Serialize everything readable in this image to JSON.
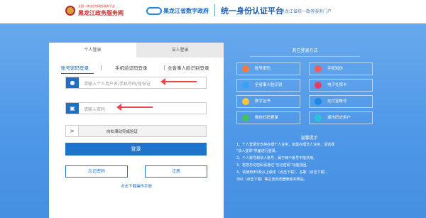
{
  "header": {
    "site_small": "全国一体化在线政务服务平台",
    "site_name": "黑龙江政务服务网",
    "gov_name": "黑龙江省数字政府",
    "platform": "统一身份认证平台",
    "portal": "黑龙江省统一政务服务门户"
  },
  "tabs": {
    "person": "个人登录",
    "legal": "法人登录"
  },
  "methods": {
    "password": "账号密码登录",
    "sms": "手机验证码登录",
    "face": "全省事人脸识别登录"
  },
  "inputs": {
    "username_placeholder": "请输入个人用户名/手机号码/身份证",
    "password_placeholder": "请输入密码"
  },
  "slider": {
    "handle": ">",
    "text": "向右滑动完成验证"
  },
  "buttons": {
    "login": "登录",
    "forgot": "忘记密码",
    "register": "注册",
    "manual": "点击下载操作手册"
  },
  "other": {
    "title": "其它登录方式",
    "options": [
      {
        "label": "账号密码"
      },
      {
        "label": "手机短信"
      },
      {
        "label": "全省事人脸识别"
      },
      {
        "label": "电子社保卡"
      },
      {
        "label": "数字证书"
      },
      {
        "label": "支付宝账号"
      },
      {
        "label": "微信扫码登录"
      },
      {
        "label": "湖市历史用户"
      }
    ]
  },
  "tips": {
    "title": "温馨提示",
    "lines": [
      "1、个人登录仅支持办理个人业务，如需办理法人业务，请选择",
      "\"法人登录\"界面进行登录。",
      "2、个人账号和法人账号，属于两个账号不能共用。",
      "3、若您忘记密码请通过“忘记密码”功能找回。",
      "4、请使用IE9及以上版本（点击下载）、谷歌（点击下载）、",
      "360（点击下载）等主流浏览器使用本网站。"
    ]
  },
  "colors": {
    "accent": "#1f73c9",
    "arrow": "#e34b4b",
    "background": "#4f98e8"
  }
}
